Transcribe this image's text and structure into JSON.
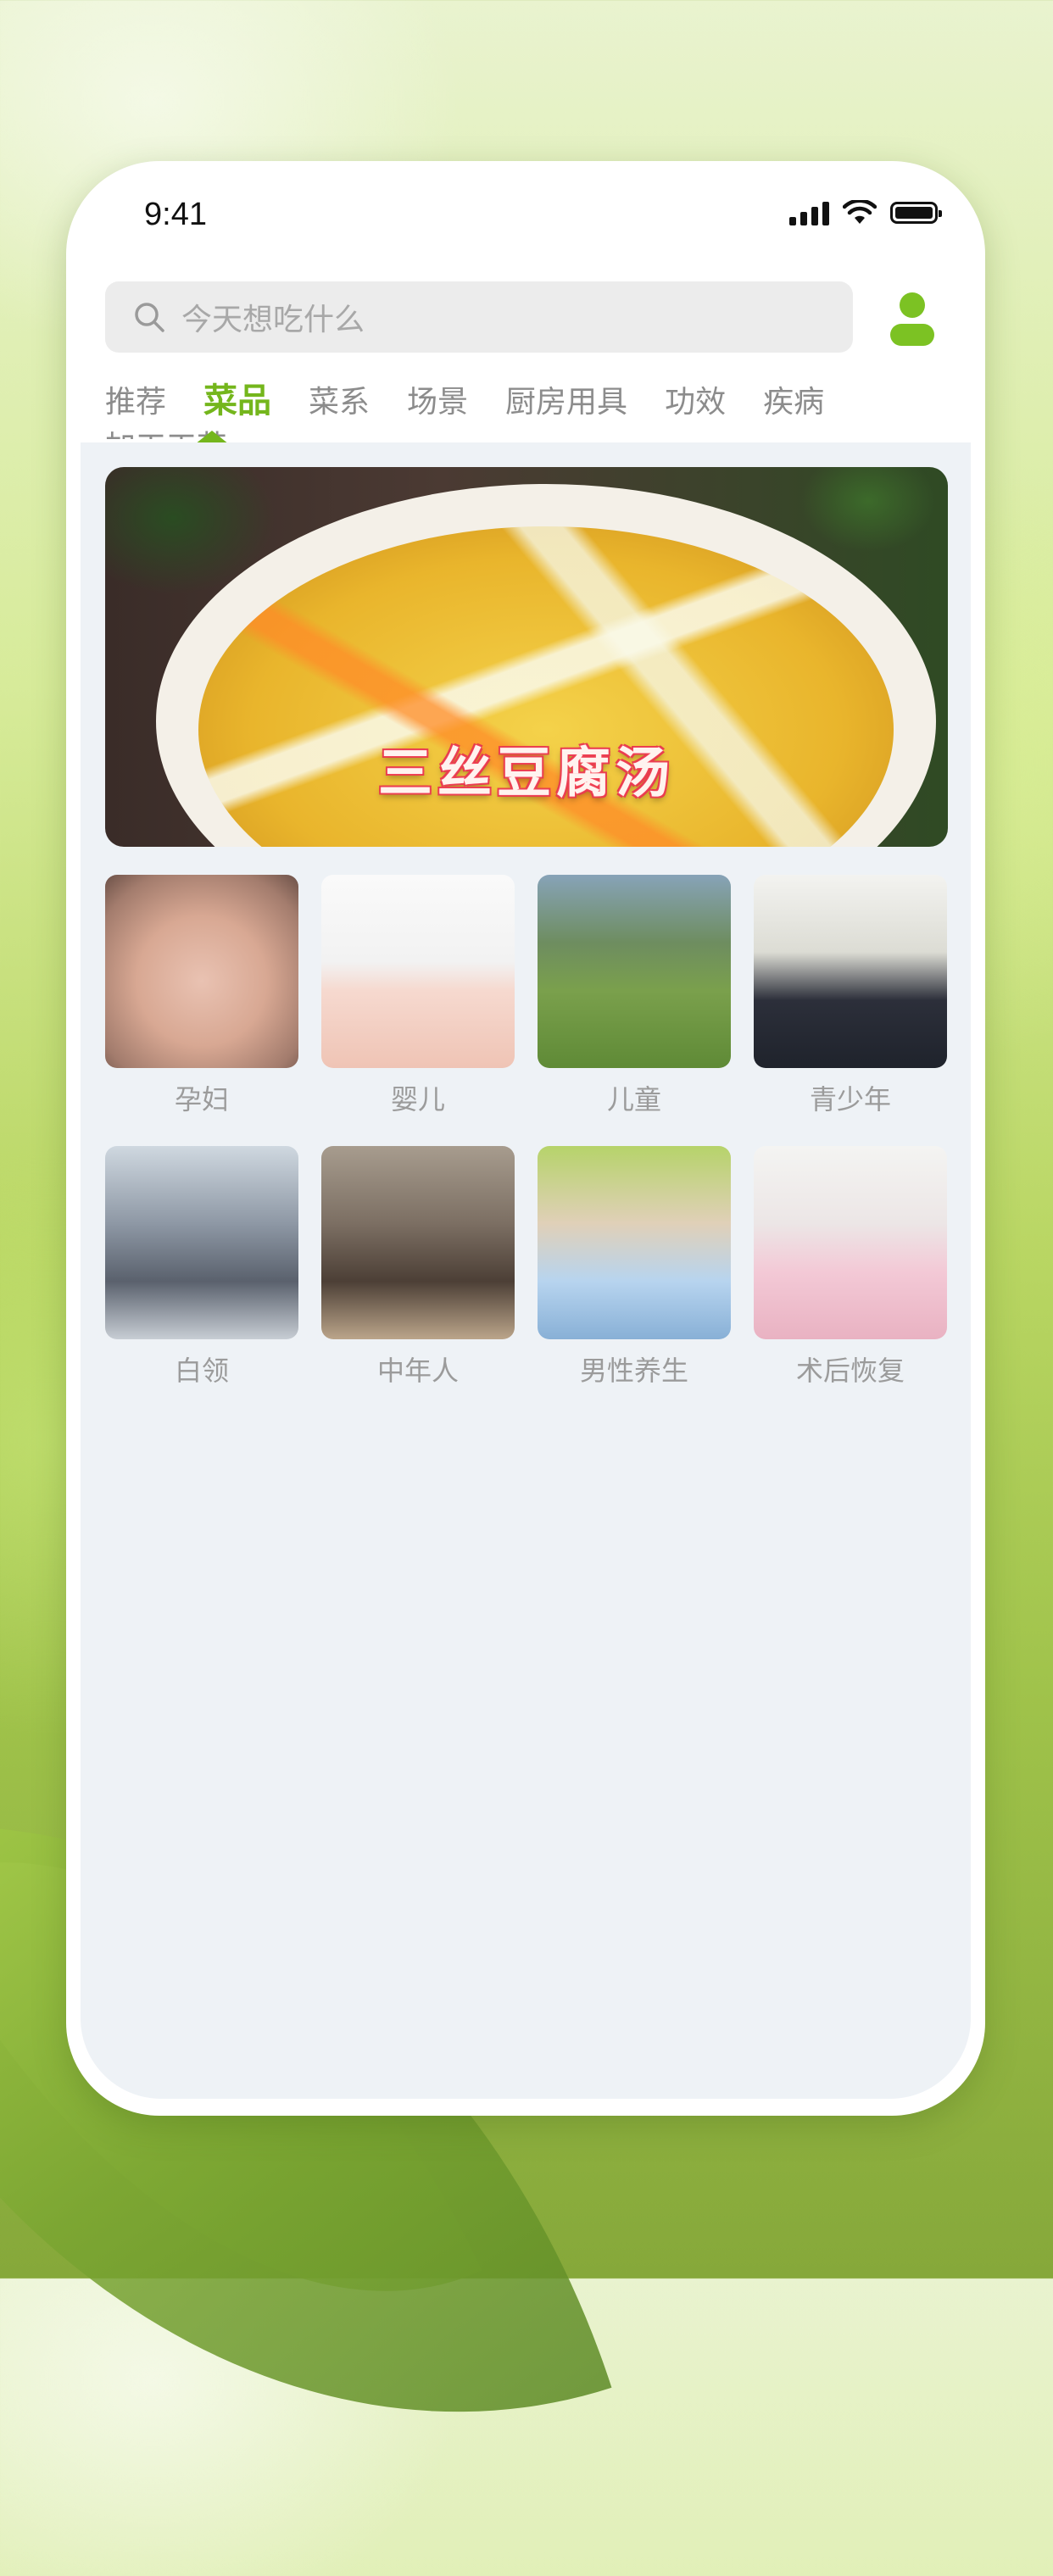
{
  "status_bar": {
    "time": "9:41"
  },
  "search": {
    "placeholder": "今天想吃什么"
  },
  "tabs": [
    {
      "label": "推荐",
      "active": false
    },
    {
      "label": "菜品",
      "active": true
    },
    {
      "label": "菜系",
      "active": false
    },
    {
      "label": "场景",
      "active": false
    },
    {
      "label": "厨房用具",
      "active": false
    },
    {
      "label": "功效",
      "active": false
    },
    {
      "label": "疾病",
      "active": false
    },
    {
      "label": "加工工艺",
      "active": false
    }
  ],
  "banner": {
    "title": "三丝豆腐汤"
  },
  "categories": [
    {
      "label": "孕妇"
    },
    {
      "label": "婴儿"
    },
    {
      "label": "儿童"
    },
    {
      "label": "青少年"
    },
    {
      "label": "白领"
    },
    {
      "label": "中年人"
    },
    {
      "label": "男性养生"
    },
    {
      "label": "术后恢复"
    }
  ],
  "colors": {
    "accent": "#74b61c",
    "content_bg": "#eef2f6"
  }
}
